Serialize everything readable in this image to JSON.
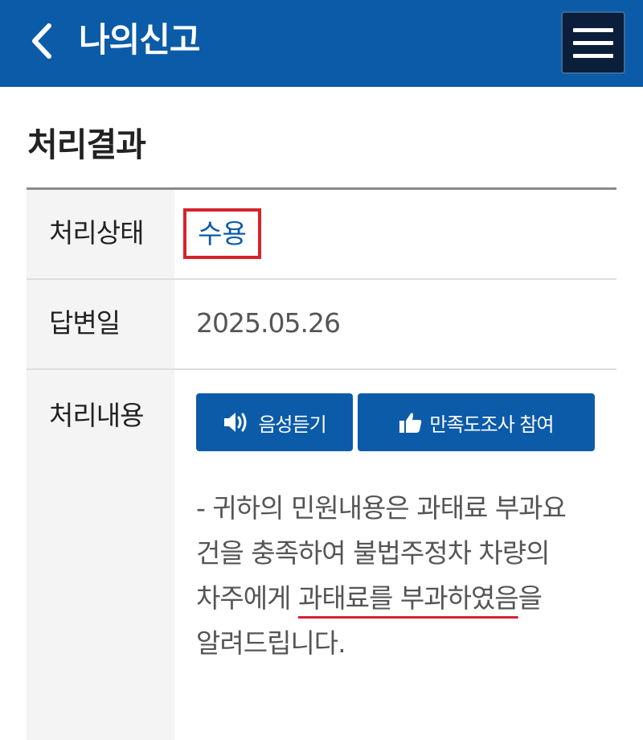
{
  "header": {
    "title": "나의신고",
    "back_icon": "chevron-left-icon",
    "menu_icon": "hamburger-menu-icon",
    "background_color": "#0b5ba8"
  },
  "section": {
    "title": "처리결과"
  },
  "table": {
    "rows": [
      {
        "label": "처리상태",
        "value": "수용"
      },
      {
        "label": "답변일",
        "value": "2025.05.26"
      },
      {
        "label": "처리내용"
      }
    ]
  },
  "actions": {
    "listen_label": "음성듣기",
    "listen_icon": "speaker-icon",
    "survey_label": "만족도조사 참여",
    "survey_icon": "thumbs-up-icon",
    "button_color": "#0b5ba8"
  },
  "content": {
    "line1": "- 귀하의 민원내용은 과태료 부과요",
    "line2": "건을 충족하여 불법주정차 차량의",
    "line3_prefix": "차주에게 ",
    "line3_highlight": "과태료를 부과하였음",
    "line3_suffix": "을",
    "line4": "알려드립니다."
  },
  "annotations": {
    "highlight_color": "#d6232b"
  }
}
